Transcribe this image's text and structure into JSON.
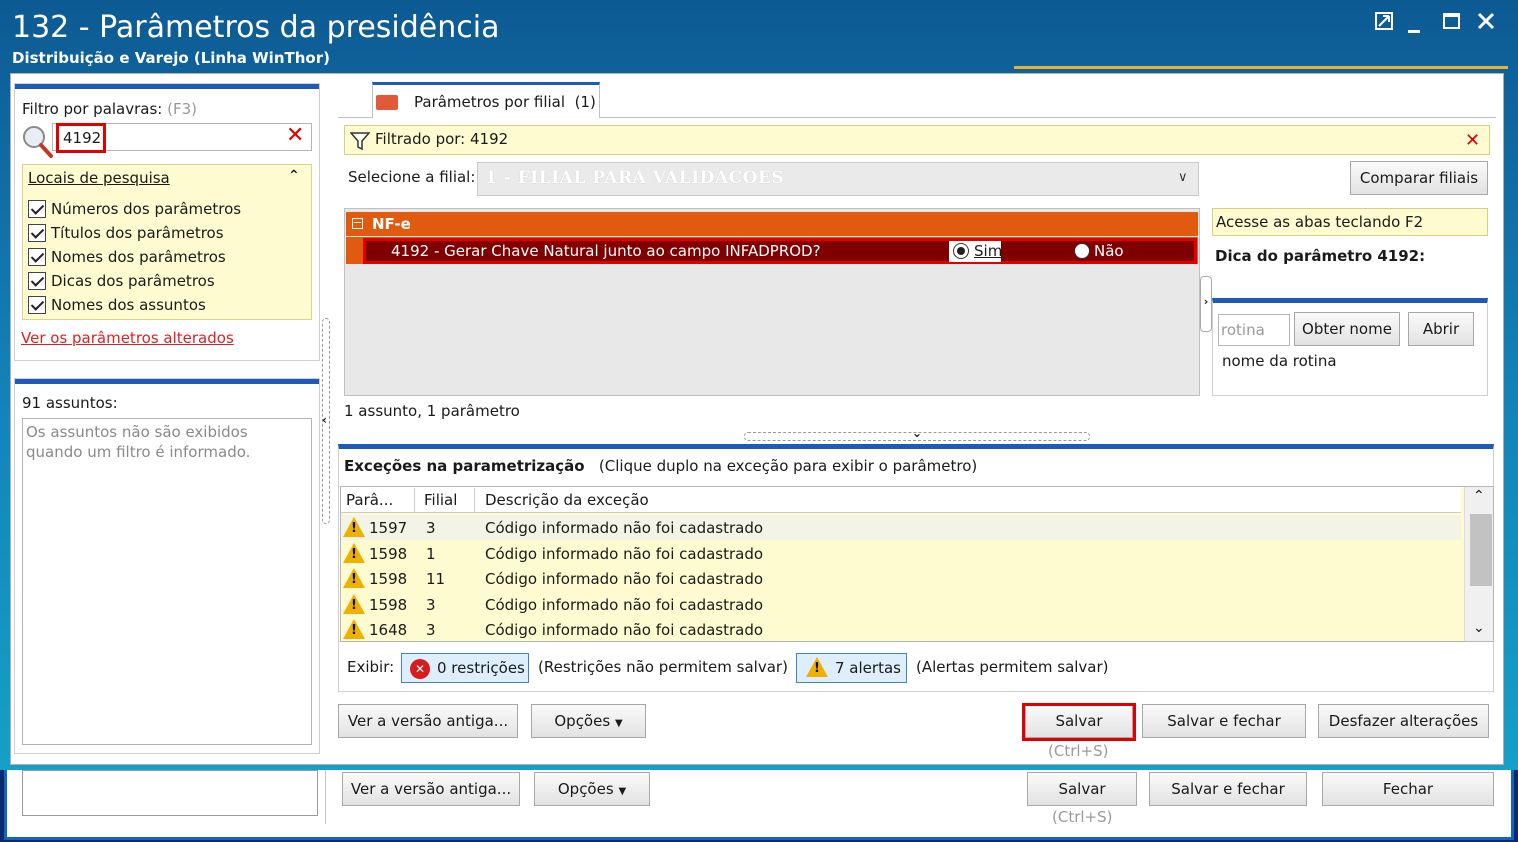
{
  "window": {
    "title": "132 - Parâmetros da presidência",
    "subtitle": "Distribuição e Varejo (Linha WinThor)"
  },
  "left": {
    "filter_label": "Filtro por palavras:",
    "filter_shortcut": "(F3)",
    "search_value": "4192",
    "locais_title": "Locais de pesquisa",
    "locais_items": [
      {
        "label": "Números dos parâmetros",
        "checked": true
      },
      {
        "label": "Títulos dos parâmetros",
        "checked": true
      },
      {
        "label": "Nomes dos parâmetros",
        "checked": true
      },
      {
        "label": "Dicas dos parâmetros",
        "checked": true
      },
      {
        "label": "Nomes dos assuntos",
        "checked": true
      }
    ],
    "changed_link": "Ver os parâmetros alterados",
    "assuntos_label": "91 assuntos:",
    "assuntos_msg": "Os assuntos não são exibidos quando um filtro é informado."
  },
  "tab": {
    "label": "Parâmetros por filial",
    "count": "(1)"
  },
  "filtered": {
    "label": "Filtrado por: 4192"
  },
  "filial": {
    "label": "Selecione a filial:",
    "value": "1 - FILIAL PARA VALIDACOES",
    "compare_button": "Comparar filiais"
  },
  "params": {
    "group": "NF-e",
    "row_text": "4192 - Gerar Chave Natural junto ao campo INFADPROD?",
    "option_sim": "Sim",
    "option_nao": "Não",
    "selected": "Sim",
    "count_label": "1 assunto, 1 parâmetro"
  },
  "right": {
    "hint": "Acesse as abas teclando F2",
    "dica_title": "Dica do parâmetro 4192:",
    "rotina_placeholder": "rotina",
    "obter_button": "Obter nome",
    "abrir_button": "Abrir",
    "rotina_nome": "nome da rotina"
  },
  "exceptions": {
    "title_bold": "Exceções na parametrização",
    "title_note": "(Clique duplo na exceção para exibir o parâmetro)",
    "columns": [
      "Parâ...",
      "Filial",
      "Descrição da exceção"
    ],
    "rows": [
      {
        "param": "1597",
        "filial": "3",
        "desc": "Código informado não foi cadastrado"
      },
      {
        "param": "1598",
        "filial": "1",
        "desc": "Código informado não foi cadastrado"
      },
      {
        "param": "1598",
        "filial": "11",
        "desc": "Código informado não foi cadastrado"
      },
      {
        "param": "1598",
        "filial": "3",
        "desc": "Código informado não foi cadastrado"
      },
      {
        "param": "1648",
        "filial": "3",
        "desc": "Código informado não foi cadastrado"
      }
    ],
    "exibir_label": "Exibir:",
    "restricoes_button": "0 restrições",
    "restricoes_note": "(Restrições não permitem salvar)",
    "alertas_button": "7 alertas",
    "alertas_note": "(Alertas permitem salvar)"
  },
  "footer": {
    "versao_button": "Ver a versão antiga...",
    "opcoes_button": "Opções",
    "salvar_button": "Salvar",
    "salvar_shortcut": "(Ctrl+S)",
    "salvar_fechar_button": "Salvar e fechar",
    "desfazer_button": "Desfazer alterações"
  },
  "background_footer": {
    "versao_button": "Ver a versão antiga...",
    "opcoes_button": "Opções",
    "salvar_button": "Salvar",
    "salvar_shortcut": "(Ctrl+S)",
    "salvar_fechar_button": "Salvar e fechar",
    "fechar_button": "Fechar"
  },
  "colors": {
    "accent_blue": "#1e5bb8",
    "group_orange": "#e05b0f",
    "selected_row": "#7e0000",
    "highlight_red": "#e00000",
    "note_yellow": "#fffbd0"
  }
}
